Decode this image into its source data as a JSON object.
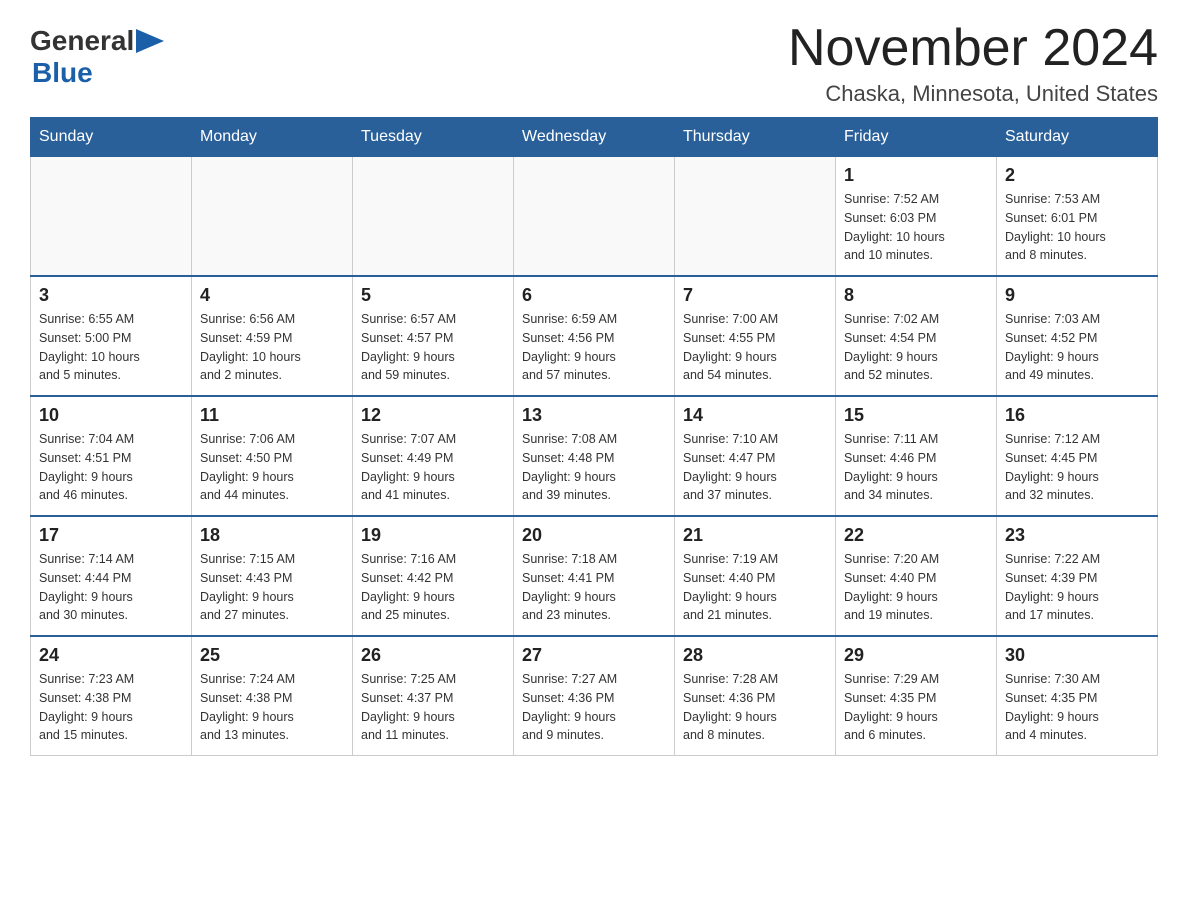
{
  "header": {
    "logo_general": "General",
    "logo_blue": "Blue",
    "month_title": "November 2024",
    "location": "Chaska, Minnesota, United States"
  },
  "weekdays": [
    "Sunday",
    "Monday",
    "Tuesday",
    "Wednesday",
    "Thursday",
    "Friday",
    "Saturday"
  ],
  "weeks": [
    [
      {
        "day": "",
        "info": ""
      },
      {
        "day": "",
        "info": ""
      },
      {
        "day": "",
        "info": ""
      },
      {
        "day": "",
        "info": ""
      },
      {
        "day": "",
        "info": ""
      },
      {
        "day": "1",
        "info": "Sunrise: 7:52 AM\nSunset: 6:03 PM\nDaylight: 10 hours\nand 10 minutes."
      },
      {
        "day": "2",
        "info": "Sunrise: 7:53 AM\nSunset: 6:01 PM\nDaylight: 10 hours\nand 8 minutes."
      }
    ],
    [
      {
        "day": "3",
        "info": "Sunrise: 6:55 AM\nSunset: 5:00 PM\nDaylight: 10 hours\nand 5 minutes."
      },
      {
        "day": "4",
        "info": "Sunrise: 6:56 AM\nSunset: 4:59 PM\nDaylight: 10 hours\nand 2 minutes."
      },
      {
        "day": "5",
        "info": "Sunrise: 6:57 AM\nSunset: 4:57 PM\nDaylight: 9 hours\nand 59 minutes."
      },
      {
        "day": "6",
        "info": "Sunrise: 6:59 AM\nSunset: 4:56 PM\nDaylight: 9 hours\nand 57 minutes."
      },
      {
        "day": "7",
        "info": "Sunrise: 7:00 AM\nSunset: 4:55 PM\nDaylight: 9 hours\nand 54 minutes."
      },
      {
        "day": "8",
        "info": "Sunrise: 7:02 AM\nSunset: 4:54 PM\nDaylight: 9 hours\nand 52 minutes."
      },
      {
        "day": "9",
        "info": "Sunrise: 7:03 AM\nSunset: 4:52 PM\nDaylight: 9 hours\nand 49 minutes."
      }
    ],
    [
      {
        "day": "10",
        "info": "Sunrise: 7:04 AM\nSunset: 4:51 PM\nDaylight: 9 hours\nand 46 minutes."
      },
      {
        "day": "11",
        "info": "Sunrise: 7:06 AM\nSunset: 4:50 PM\nDaylight: 9 hours\nand 44 minutes."
      },
      {
        "day": "12",
        "info": "Sunrise: 7:07 AM\nSunset: 4:49 PM\nDaylight: 9 hours\nand 41 minutes."
      },
      {
        "day": "13",
        "info": "Sunrise: 7:08 AM\nSunset: 4:48 PM\nDaylight: 9 hours\nand 39 minutes."
      },
      {
        "day": "14",
        "info": "Sunrise: 7:10 AM\nSunset: 4:47 PM\nDaylight: 9 hours\nand 37 minutes."
      },
      {
        "day": "15",
        "info": "Sunrise: 7:11 AM\nSunset: 4:46 PM\nDaylight: 9 hours\nand 34 minutes."
      },
      {
        "day": "16",
        "info": "Sunrise: 7:12 AM\nSunset: 4:45 PM\nDaylight: 9 hours\nand 32 minutes."
      }
    ],
    [
      {
        "day": "17",
        "info": "Sunrise: 7:14 AM\nSunset: 4:44 PM\nDaylight: 9 hours\nand 30 minutes."
      },
      {
        "day": "18",
        "info": "Sunrise: 7:15 AM\nSunset: 4:43 PM\nDaylight: 9 hours\nand 27 minutes."
      },
      {
        "day": "19",
        "info": "Sunrise: 7:16 AM\nSunset: 4:42 PM\nDaylight: 9 hours\nand 25 minutes."
      },
      {
        "day": "20",
        "info": "Sunrise: 7:18 AM\nSunset: 4:41 PM\nDaylight: 9 hours\nand 23 minutes."
      },
      {
        "day": "21",
        "info": "Sunrise: 7:19 AM\nSunset: 4:40 PM\nDaylight: 9 hours\nand 21 minutes."
      },
      {
        "day": "22",
        "info": "Sunrise: 7:20 AM\nSunset: 4:40 PM\nDaylight: 9 hours\nand 19 minutes."
      },
      {
        "day": "23",
        "info": "Sunrise: 7:22 AM\nSunset: 4:39 PM\nDaylight: 9 hours\nand 17 minutes."
      }
    ],
    [
      {
        "day": "24",
        "info": "Sunrise: 7:23 AM\nSunset: 4:38 PM\nDaylight: 9 hours\nand 15 minutes."
      },
      {
        "day": "25",
        "info": "Sunrise: 7:24 AM\nSunset: 4:38 PM\nDaylight: 9 hours\nand 13 minutes."
      },
      {
        "day": "26",
        "info": "Sunrise: 7:25 AM\nSunset: 4:37 PM\nDaylight: 9 hours\nand 11 minutes."
      },
      {
        "day": "27",
        "info": "Sunrise: 7:27 AM\nSunset: 4:36 PM\nDaylight: 9 hours\nand 9 minutes."
      },
      {
        "day": "28",
        "info": "Sunrise: 7:28 AM\nSunset: 4:36 PM\nDaylight: 9 hours\nand 8 minutes."
      },
      {
        "day": "29",
        "info": "Sunrise: 7:29 AM\nSunset: 4:35 PM\nDaylight: 9 hours\nand 6 minutes."
      },
      {
        "day": "30",
        "info": "Sunrise: 7:30 AM\nSunset: 4:35 PM\nDaylight: 9 hours\nand 4 minutes."
      }
    ]
  ]
}
